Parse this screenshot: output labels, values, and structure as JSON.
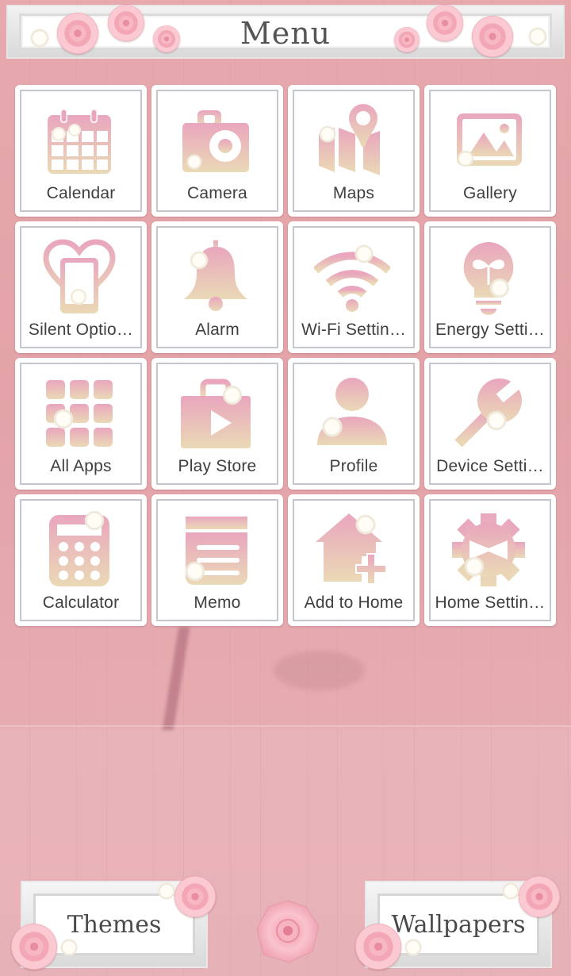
{
  "header": {
    "title": "Menu"
  },
  "colors": {
    "background": "#e6a9ae",
    "tile": "#ffffff",
    "icon_top": "#e9a6be",
    "icon_bottom": "#ead9b6",
    "label": "#3f3f3f"
  },
  "grid": {
    "items": [
      {
        "label": "Calendar",
        "icon": "calendar-icon"
      },
      {
        "label": "Camera",
        "icon": "camera-icon"
      },
      {
        "label": "Maps",
        "icon": "map-icon"
      },
      {
        "label": "Gallery",
        "icon": "gallery-icon"
      },
      {
        "label": "Silent Optio…",
        "icon": "silent-heart-phone-icon"
      },
      {
        "label": "Alarm",
        "icon": "bell-icon"
      },
      {
        "label": "Wi-Fi Settin…",
        "icon": "wifi-icon"
      },
      {
        "label": "Energy Setti…",
        "icon": "lightbulb-icon"
      },
      {
        "label": "All Apps",
        "icon": "app-grid-icon"
      },
      {
        "label": "Play Store",
        "icon": "play-store-icon"
      },
      {
        "label": "Profile",
        "icon": "profile-icon"
      },
      {
        "label": "Device Setti…",
        "icon": "wrench-icon"
      },
      {
        "label": "Calculator",
        "icon": "calculator-icon"
      },
      {
        "label": "Memo",
        "icon": "memo-icon"
      },
      {
        "label": "Add to Home",
        "icon": "house-plus-icon"
      },
      {
        "label": "Home Settin…",
        "icon": "gear-icon"
      }
    ]
  },
  "footer": {
    "themes_label": "Themes",
    "wallpapers_label": "Wallpapers"
  }
}
